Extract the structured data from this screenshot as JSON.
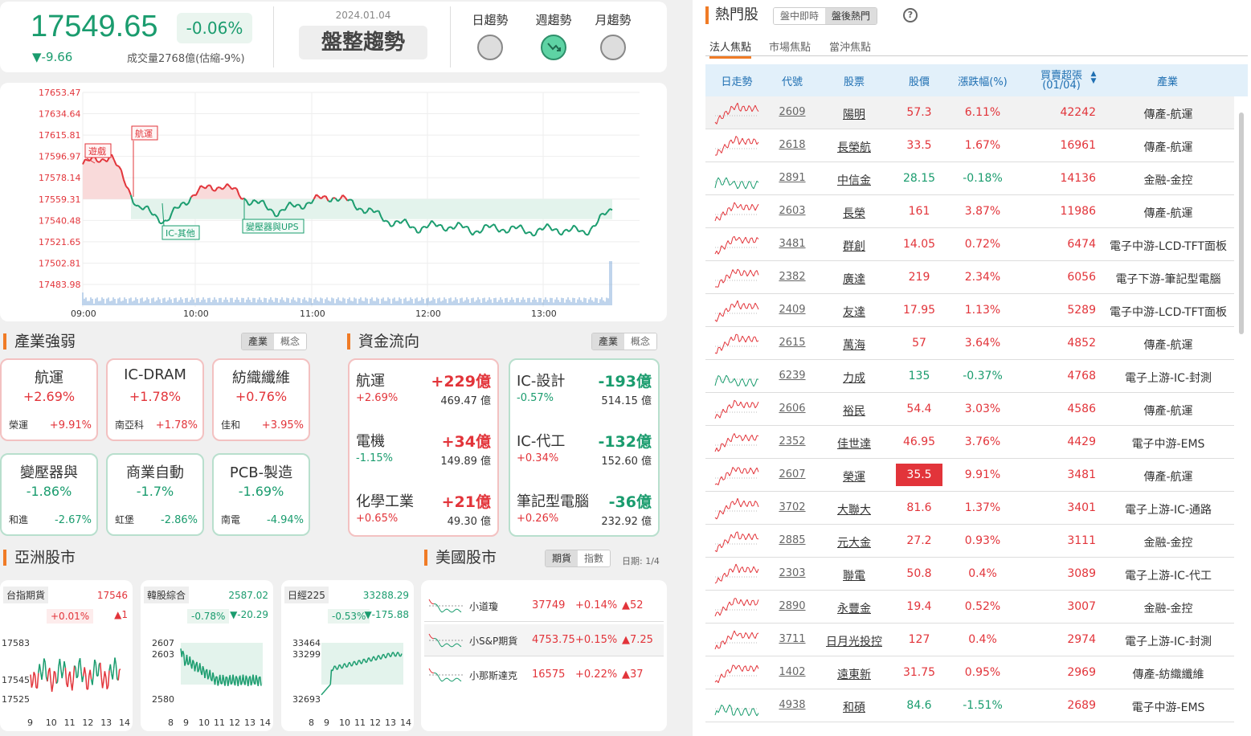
{
  "index": {
    "price": "17549.65",
    "change_pct": "-0.06%",
    "change_pts": "▼-9.66",
    "volume": "成交量2768億(估縮-9%)"
  },
  "trend": {
    "date": "2024.01.04",
    "title": "盤整趨勢",
    "daily": "日趨勢",
    "weekly": "週趨勢",
    "monthly": "月趨勢"
  },
  "chart": {
    "y_ticks": [
      "17653.47",
      "17634.64",
      "17615.81",
      "17596.97",
      "17578.14",
      "17559.31",
      "17540.48",
      "17521.65",
      "17502.81",
      "17483.98"
    ],
    "x_ticks": [
      "09:00",
      "10:00",
      "11:00",
      "12:00",
      "13:00"
    ],
    "annotations": {
      "a1": "遊戲",
      "a2": "航運",
      "a3": "IC-其他",
      "a4": "變壓器與UPS"
    }
  },
  "chart_data": {
    "type": "line",
    "x": [
      "09:00",
      "09:15",
      "09:30",
      "09:45",
      "10:00",
      "10:15",
      "10:30",
      "10:45",
      "11:00",
      "11:15",
      "11:30",
      "11:45",
      "12:00",
      "12:15",
      "12:30",
      "12:45",
      "13:00",
      "13:15",
      "13:25",
      "13:30"
    ],
    "values": [
      17590,
      17598,
      17552,
      17540,
      17565,
      17572,
      17558,
      17548,
      17556,
      17562,
      17552,
      17540,
      17534,
      17536,
      17532,
      17534,
      17531,
      17533,
      17530,
      17549.65
    ],
    "reference": 17559.31,
    "ylim": [
      17483.98,
      17653.47
    ]
  },
  "industry": {
    "title": "產業強弱",
    "seg1": "產業",
    "seg2": "概念",
    "items": [
      {
        "name": "航運",
        "pct": "+2.69%",
        "stock": "榮運",
        "spct": "+9.91%"
      },
      {
        "name": "IC-DRAM",
        "pct": "+1.78%",
        "stock": "南亞科",
        "spct": "+1.78%"
      },
      {
        "name": "紡織纖維",
        "pct": "+0.76%",
        "stock": "佳和",
        "spct": "+3.95%"
      },
      {
        "name": "變壓器與",
        "pct": "-1.86%",
        "stock": "和進",
        "spct": "-2.67%"
      },
      {
        "name": "商業自動",
        "pct": "-1.7%",
        "stock": "虹堡",
        "spct": "-2.86%"
      },
      {
        "name": "PCB-製造",
        "pct": "-1.69%",
        "stock": "南電",
        "spct": "-4.94%"
      }
    ]
  },
  "flow": {
    "title": "資金流向",
    "seg1": "產業",
    "seg2": "概念",
    "inflow": [
      {
        "name": "航運",
        "amt": "+229億",
        "pct": "+2.69%",
        "val": "469.47 億"
      },
      {
        "name": "電機",
        "amt": "+34億",
        "pct": "-1.15%",
        "val": "149.89 億"
      },
      {
        "name": "化學工業",
        "amt": "+21億",
        "pct": "+0.65%",
        "val": "49.30 億"
      }
    ],
    "outflow": [
      {
        "name": "IC-設計",
        "amt": "-193億",
        "pct": "-0.57%",
        "val": "514.15 億"
      },
      {
        "name": "IC-代工",
        "amt": "-132億",
        "pct": "+0.34%",
        "val": "152.60 億"
      },
      {
        "name": "筆記型電腦",
        "amt": "-36億",
        "pct": "+0.26%",
        "val": "232.92 億"
      }
    ]
  },
  "asia": {
    "title": "亞洲股市",
    "m1": {
      "tag": "台指期貨",
      "price": "17546",
      "pct": "+0.01%",
      "pts": "▲1",
      "y1": "17583",
      "y2": "17545",
      "y3": "17525",
      "x": [
        "9",
        "10",
        "11",
        "12",
        "13",
        "14"
      ]
    },
    "m2": {
      "tag": "韓股綜合",
      "price": "2587.02",
      "pct": "-0.78%",
      "pts": "▼-20.29",
      "y1": "2607",
      "y2": "2603",
      "y3": "2580",
      "x": [
        "8",
        "9",
        "10",
        "11",
        "12",
        "13",
        "14"
      ]
    },
    "m3": {
      "tag": "日經225",
      "price": "33288.29",
      "pct": "-0.53%",
      "pts": "▼-175.88",
      "y1": "33464",
      "y2": "33299",
      "y3": "32693",
      "x": [
        "8",
        "9",
        "10",
        "11",
        "12",
        "13",
        "14"
      ]
    }
  },
  "us": {
    "title": "美國股市",
    "seg1": "期貨",
    "seg2": "指數",
    "date": "日期: 1/4",
    "rows": [
      {
        "name": "小道瓊",
        "price": "37749",
        "pct": "+0.14%",
        "pts": "▲52"
      },
      {
        "name": "小S&P期貨",
        "price": "4753.75",
        "pct": "+0.15%",
        "pts": "▲7.25"
      },
      {
        "name": "小那斯達克",
        "price": "16575",
        "pct": "+0.22%",
        "pts": "▲37"
      }
    ]
  },
  "hot": {
    "title": "熱門股",
    "seg1": "盤中即時",
    "seg2": "盤後熱門",
    "help": "?",
    "tabs": [
      "法人焦點",
      "市場焦點",
      "當沖焦點"
    ],
    "headers": {
      "trend": "日走勢",
      "code": "代號",
      "name": "股票",
      "price": "股價",
      "pct": "漲跌幅(%)",
      "buy": "買賣超張",
      "buy_sub": "(01/04)",
      "ind": "產業"
    },
    "rows": [
      {
        "code": "2609",
        "name": "陽明",
        "price": "57.3",
        "pct": "6.11%",
        "buy": "42242",
        "ind": "傳產-航運",
        "dir": "up"
      },
      {
        "code": "2618",
        "name": "長榮航",
        "price": "33.5",
        "pct": "1.67%",
        "buy": "16961",
        "ind": "傳產-航運",
        "dir": "up"
      },
      {
        "code": "2891",
        "name": "中信金",
        "price": "28.15",
        "pct": "-0.18%",
        "buy": "14136",
        "ind": "金融-金控",
        "dir": "dn"
      },
      {
        "code": "2603",
        "name": "長榮",
        "price": "161",
        "pct": "3.87%",
        "buy": "11986",
        "ind": "傳產-航運",
        "dir": "up"
      },
      {
        "code": "3481",
        "name": "群創",
        "price": "14.05",
        "pct": "0.72%",
        "buy": "6474",
        "ind": "電子中游-LCD-TFT面板",
        "dir": "up"
      },
      {
        "code": "2382",
        "name": "廣達",
        "price": "219",
        "pct": "2.34%",
        "buy": "6056",
        "ind": "電子下游-筆記型電腦",
        "dir": "up"
      },
      {
        "code": "2409",
        "name": "友達",
        "price": "17.95",
        "pct": "1.13%",
        "buy": "5289",
        "ind": "電子中游-LCD-TFT面板",
        "dir": "up"
      },
      {
        "code": "2615",
        "name": "萬海",
        "price": "57",
        "pct": "3.64%",
        "buy": "4852",
        "ind": "傳產-航運",
        "dir": "up"
      },
      {
        "code": "6239",
        "name": "力成",
        "price": "135",
        "pct": "-0.37%",
        "buy": "4768",
        "ind": "電子上游-IC-封測",
        "dir": "dn"
      },
      {
        "code": "2606",
        "name": "裕民",
        "price": "54.4",
        "pct": "3.03%",
        "buy": "4586",
        "ind": "傳產-航運",
        "dir": "up"
      },
      {
        "code": "2352",
        "name": "佳世達",
        "price": "46.95",
        "pct": "3.76%",
        "buy": "4429",
        "ind": "電子中游-EMS",
        "dir": "up"
      },
      {
        "code": "2607",
        "name": "榮運",
        "price": "35.5",
        "pct": "9.91%",
        "buy": "3481",
        "ind": "傳產-航運",
        "dir": "limit"
      },
      {
        "code": "3702",
        "name": "大聯大",
        "price": "81.6",
        "pct": "1.37%",
        "buy": "3401",
        "ind": "電子上游-IC-通路",
        "dir": "up"
      },
      {
        "code": "2885",
        "name": "元大金",
        "price": "27.2",
        "pct": "0.93%",
        "buy": "3111",
        "ind": "金融-金控",
        "dir": "up"
      },
      {
        "code": "2303",
        "name": "聯電",
        "price": "50.8",
        "pct": "0.4%",
        "buy": "3089",
        "ind": "電子上游-IC-代工",
        "dir": "up"
      },
      {
        "code": "2890",
        "name": "永豐金",
        "price": "19.4",
        "pct": "0.52%",
        "buy": "3007",
        "ind": "金融-金控",
        "dir": "up"
      },
      {
        "code": "3711",
        "name": "日月光投控",
        "price": "127",
        "pct": "0.4%",
        "buy": "2974",
        "ind": "電子上游-IC-封測",
        "dir": "up"
      },
      {
        "code": "1402",
        "name": "遠東新",
        "price": "31.75",
        "pct": "0.95%",
        "buy": "2969",
        "ind": "傳產-紡織纖維",
        "dir": "up"
      },
      {
        "code": "4938",
        "name": "和碩",
        "price": "84.6",
        "pct": "-1.51%",
        "buy": "2689",
        "ind": "電子中游-EMS",
        "dir": "dn"
      }
    ]
  },
  "colors": {
    "up": "#e2343a",
    "down": "#1a9c6e",
    "accent": "#f07b26",
    "header_bg": "#e2f0fa"
  }
}
